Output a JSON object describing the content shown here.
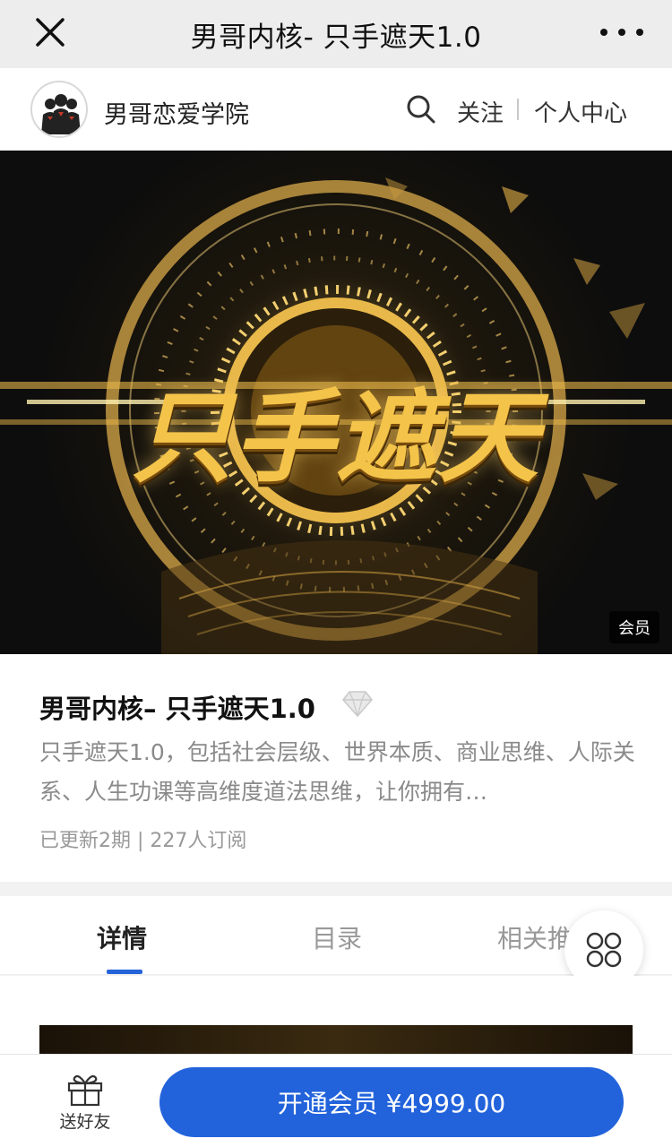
{
  "topbar": {
    "title": "男哥内核- 只手遮天1.0"
  },
  "shop": {
    "name": "男哥恋爱学院",
    "follow": "关注",
    "center": "个人中心"
  },
  "banner": {
    "headline": "只手遮天",
    "badge": "会员"
  },
  "course": {
    "title": "男哥内核– 只手遮天1.0",
    "desc": "只手遮天1.0，包括社会层级、世界本质、商业思维、人际关系、人生功课等高维度道法思维，让你拥有…",
    "meta": "已更新2期 | 227人订阅"
  },
  "tabs": [
    {
      "label": "详情"
    },
    {
      "label": "目录"
    },
    {
      "label": "相关推"
    }
  ],
  "bottom": {
    "gift_label": "送好友",
    "buy_label": "开通会员 ¥4999.00"
  },
  "colors": {
    "accent": "#2263db",
    "gold": "#e8b84a"
  }
}
